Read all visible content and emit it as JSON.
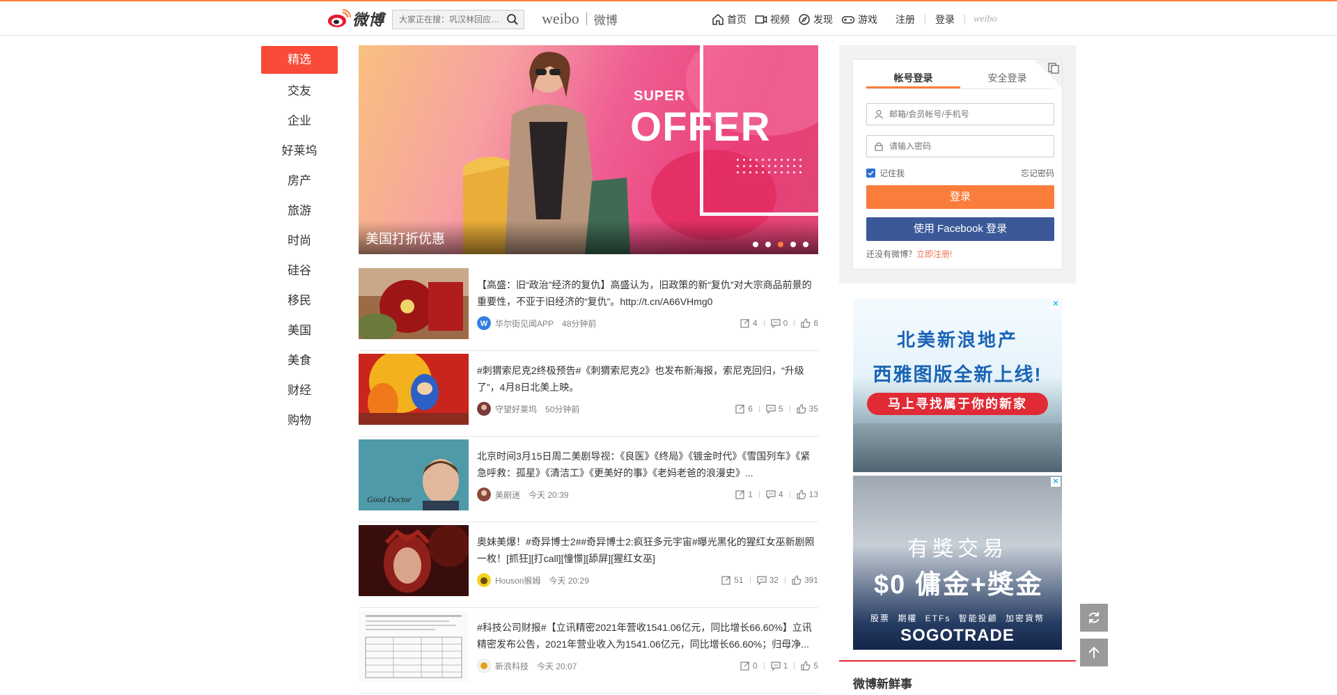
{
  "header": {
    "logo_text": "微博",
    "search_placeholder": "大家正在搜：巩汉林回应…",
    "brand_en": "weibo",
    "brand_cn": "微博",
    "nav": [
      {
        "label": "首页",
        "icon": "home-icon"
      },
      {
        "label": "视频",
        "icon": "video-icon"
      },
      {
        "label": "发现",
        "icon": "discover-icon"
      },
      {
        "label": "游戏",
        "icon": "game-icon"
      }
    ],
    "register": "注册",
    "login": "登录",
    "weibo_small": "weibo"
  },
  "categories": [
    "精选",
    "交友",
    "企业",
    "好莱坞",
    "房产",
    "旅游",
    "时尚",
    "硅谷",
    "移民",
    "美国",
    "美食",
    "财经",
    "购物"
  ],
  "active_category": "精选",
  "banner": {
    "super": "SUPER",
    "offer": "OFFER",
    "caption": "美国打折优惠",
    "active_dot": 2,
    "dot_count": 5
  },
  "feed": [
    {
      "text": "【高盛：旧“政治”经济的复仇】高盛认为，旧政策的新“复仇”对大宗商品前景的重要性，不亚于旧经济的“复仇”。http://t.cn/A66VHmg0",
      "source": "华尔街见闻APP",
      "time": "48分钟前",
      "reposts": "4",
      "comments": "0",
      "likes": "6"
    },
    {
      "text": "#刺猬索尼克2终极预告#《刺猬索尼克2》也发布新海报，索尼克回归，“升级了”，4月8日北美上映。",
      "source": "守望好莱坞",
      "time": "50分钟前",
      "reposts": "6",
      "comments": "5",
      "likes": "35"
    },
    {
      "text": "北京时间3月15日周二美剧导视：《良医》《终局》《镀金时代》《雪国列车》《紧急呼救：孤星》《清洁工》《更美好的事》《老妈老爸的浪漫史》...",
      "source": "美剧迷",
      "time": "今天 20:39",
      "reposts": "1",
      "comments": "4",
      "likes": "13"
    },
    {
      "text": "奥妹美爆！#奇异博士2##奇异博士2:疯狂多元宇宙#曝光黑化的猩红女巫新剧照一枚！[抓狂][打call][憧憬][舔屏][猩红女巫]",
      "source": "Houson猴姆",
      "time": "今天 20:29",
      "reposts": "51",
      "comments": "32",
      "likes": "391"
    },
    {
      "text": "#科技公司财报#【立讯精密2021年营收1541.06亿元，同比增长66.60%】立讯精密发布公告，2021年营业收入为1541.06亿元，同比增长66.60%；归母净...",
      "source": "新浪科技",
      "time": "今天 20:07",
      "reposts": "0",
      "comments": "1",
      "likes": "5"
    }
  ],
  "login": {
    "tab_account": "帐号登录",
    "tab_secure": "安全登录",
    "username_placeholder": "邮箱/会员帐号/手机号",
    "password_placeholder": "请输入密码",
    "remember": "记住我",
    "forgot": "忘记密码",
    "login_button": "登录",
    "facebook_button": "使用 Facebook 登录",
    "no_account": "还没有微博？",
    "register_link": "立即注册!"
  },
  "ads": {
    "ad1_line1": "北美新浪地产",
    "ad1_line2": "西雅图版全新上线!",
    "ad1_banner": "马上寻找属于你的新家",
    "ad2_line1": "有獎交易",
    "ad2_line2": "$0 傭金+獎金",
    "ad2_line3": "股票 期權 ETFs 智能投顧 加密貨幣",
    "ad2_brand": "SOGOTRADE",
    "close": "✕"
  },
  "sidebar_section_title": "微博新鲜事",
  "colors": {
    "accent": "#fa7d3c",
    "active_category": "#f94b37",
    "facebook": "#3b5998",
    "register_link": "#eb7350"
  }
}
